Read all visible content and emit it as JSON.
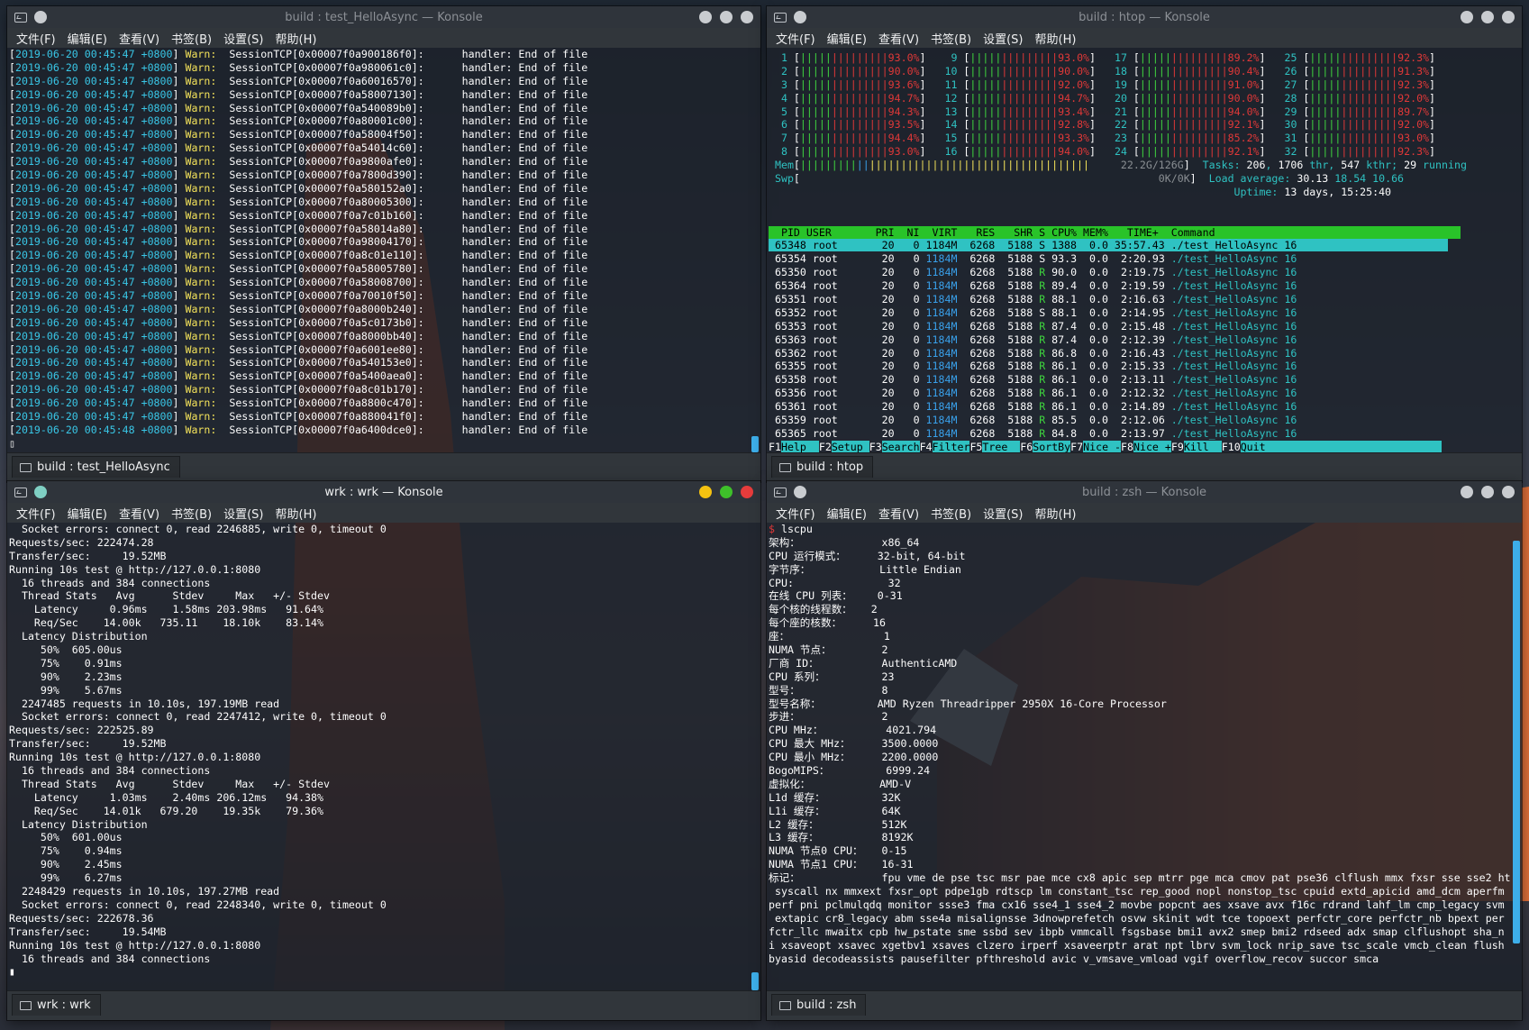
{
  "wallpaper": {
    "desc_colors": [
      "#1f2833",
      "#c2512a",
      "#e0703a"
    ]
  },
  "w1": {
    "title": "build : test_HelloAsync — Konsole",
    "tab": "build : test_HelloAsync",
    "menu": [
      "文件(F)",
      "编辑(E)",
      "查看(V)",
      "书签(B)",
      "设置(S)",
      "帮助(H)"
    ],
    "rows": [
      {
        "ts": "2019-06-20 00:45:47 +0800",
        "ptr": "0x00007f0a900186f0"
      },
      {
        "ts": "2019-06-20 00:45:47 +0800",
        "ptr": "0x00007f0a980061c0"
      },
      {
        "ts": "2019-06-20 00:45:47 +0800",
        "ptr": "0x00007f0a60016570"
      },
      {
        "ts": "2019-06-20 00:45:47 +0800",
        "ptr": "0x00007f0a58007130"
      },
      {
        "ts": "2019-06-20 00:45:47 +0800",
        "ptr": "0x00007f0a540089b0"
      },
      {
        "ts": "2019-06-20 00:45:47 +0800",
        "ptr": "0x00007f0a80001c00"
      },
      {
        "ts": "2019-06-20 00:45:47 +0800",
        "ptr": "0x00007f0a58004f50"
      },
      {
        "ts": "2019-06-20 00:45:47 +0800",
        "ptr": "0x00007f0a54014c60"
      },
      {
        "ts": "2019-06-20 00:45:47 +0800",
        "ptr": "0x00007f0a9800afe0"
      },
      {
        "ts": "2019-06-20 00:45:47 +0800",
        "ptr": "0x00007f0a7800d390"
      },
      {
        "ts": "2019-06-20 00:45:47 +0800",
        "ptr": "0x00007f0a580152a0"
      },
      {
        "ts": "2019-06-20 00:45:47 +0800",
        "ptr": "0x00007f0a80005300"
      },
      {
        "ts": "2019-06-20 00:45:47 +0800",
        "ptr": "0x00007f0a7c01b160"
      },
      {
        "ts": "2019-06-20 00:45:47 +0800",
        "ptr": "0x00007f0a58014a80"
      },
      {
        "ts": "2019-06-20 00:45:47 +0800",
        "ptr": "0x00007f0a98004170"
      },
      {
        "ts": "2019-06-20 00:45:47 +0800",
        "ptr": "0x00007f0a8c01e110"
      },
      {
        "ts": "2019-06-20 00:45:47 +0800",
        "ptr": "0x00007f0a58005780"
      },
      {
        "ts": "2019-06-20 00:45:47 +0800",
        "ptr": "0x00007f0a58008700"
      },
      {
        "ts": "2019-06-20 00:45:47 +0800",
        "ptr": "0x00007f0a70010f50"
      },
      {
        "ts": "2019-06-20 00:45:47 +0800",
        "ptr": "0x00007f0a8000b240"
      },
      {
        "ts": "2019-06-20 00:45:47 +0800",
        "ptr": "0x00007f0a5c0173b0"
      },
      {
        "ts": "2019-06-20 00:45:47 +0800",
        "ptr": "0x00007f0a8000bb40"
      },
      {
        "ts": "2019-06-20 00:45:47 +0800",
        "ptr": "0x00007f0a6001ee80"
      },
      {
        "ts": "2019-06-20 00:45:47 +0800",
        "ptr": "0x00007f0a540153e0"
      },
      {
        "ts": "2019-06-20 00:45:47 +0800",
        "ptr": "0x00007f0a5400aea0"
      },
      {
        "ts": "2019-06-20 00:45:47 +0800",
        "ptr": "0x00007f0a8c01b170"
      },
      {
        "ts": "2019-06-20 00:45:47 +0800",
        "ptr": "0x00007f0a8800c470"
      },
      {
        "ts": "2019-06-20 00:45:47 +0800",
        "ptr": "0x00007f0a880041f0"
      },
      {
        "ts": "2019-06-20 00:45:48 +0800",
        "ptr": "0x00007f0a6400dce0"
      }
    ],
    "level": "Warn:",
    "prefix": "SessionTCP",
    "msg": "handler: End of file"
  },
  "w2": {
    "title": "build : htop — Konsole",
    "tab": "build : htop",
    "menu": [
      "文件(F)",
      "编辑(E)",
      "查看(V)",
      "书签(B)",
      "设置(S)",
      "帮助(H)"
    ],
    "cpus": [
      {
        "n": "1",
        "pct": "93.0%"
      },
      {
        "n": "2",
        "pct": "90.0%"
      },
      {
        "n": "3",
        "pct": "93.6%"
      },
      {
        "n": "4",
        "pct": "94.7%"
      },
      {
        "n": "5",
        "pct": "94.3%"
      },
      {
        "n": "6",
        "pct": "93.5%"
      },
      {
        "n": "7",
        "pct": "94.4%"
      },
      {
        "n": "8",
        "pct": "93.0%"
      },
      {
        "n": "9",
        "pct": "93.0%"
      },
      {
        "n": "10",
        "pct": "90.0%"
      },
      {
        "n": "11",
        "pct": "92.0%"
      },
      {
        "n": "12",
        "pct": "94.7%"
      },
      {
        "n": "13",
        "pct": "93.4%"
      },
      {
        "n": "14",
        "pct": "92.8%"
      },
      {
        "n": "15",
        "pct": "93.3%"
      },
      {
        "n": "16",
        "pct": "94.0%"
      },
      {
        "n": "17",
        "pct": "89.2%"
      },
      {
        "n": "18",
        "pct": "90.4%"
      },
      {
        "n": "19",
        "pct": "91.0%"
      },
      {
        "n": "20",
        "pct": "90.0%"
      },
      {
        "n": "21",
        "pct": "94.0%"
      },
      {
        "n": "22",
        "pct": "92.1%"
      },
      {
        "n": "23",
        "pct": "85.2%"
      },
      {
        "n": "24",
        "pct": "92.1%"
      },
      {
        "n": "25",
        "pct": "92.3%"
      },
      {
        "n": "26",
        "pct": "91.3%"
      },
      {
        "n": "27",
        "pct": "92.3%"
      },
      {
        "n": "28",
        "pct": "92.0%"
      },
      {
        "n": "29",
        "pct": "89.7%"
      },
      {
        "n": "30",
        "pct": "92.0%"
      },
      {
        "n": "31",
        "pct": "93.0%"
      },
      {
        "n": "32",
        "pct": "92.3%"
      }
    ],
    "mem_label": "Mem",
    "mem_val": "22.2G/126G",
    "swp_label": "Swp",
    "swp_val": "0K/0K",
    "tasks_label": "Tasks:",
    "tasks": "206",
    "thr": "1706",
    "thr_label": "thr,",
    "kthr": "547",
    "kthr_label": "kthr;",
    "running": "29",
    "running_label": "running",
    "load_label": "Load average:",
    "load1": "30.13",
    "load5": "18.54",
    "load15": "10.66",
    "uptime_label": "Uptime:",
    "uptime": "13 days, 15:25:40",
    "header": "  PID USER       PRI  NI  VIRT   RES   SHR S CPU% MEM%   TIME+  Command                                       ",
    "procs": [
      {
        "pid": "65348",
        "user": "root",
        "pri": "20",
        "ni": "0",
        "virt": "1184M",
        "res": "6268",
        "shr": "5188",
        "s": "S",
        "cpu": "1388",
        "mem": "0.0",
        "time": "35:57.43",
        "cmd": "./test_HelloAsync 16"
      },
      {
        "pid": "65354",
        "user": "root",
        "pri": "20",
        "ni": "0",
        "virt": "1184M",
        "res": "6268",
        "shr": "5188",
        "s": "S",
        "cpu": "93.3",
        "mem": "0.0",
        "time": "2:20.93",
        "cmd": "./test_HelloAsync 16"
      },
      {
        "pid": "65350",
        "user": "root",
        "pri": "20",
        "ni": "0",
        "virt": "1184M",
        "res": "6268",
        "shr": "5188",
        "s": "R",
        "cpu": "90.0",
        "mem": "0.0",
        "time": "2:19.75",
        "cmd": "./test_HelloAsync 16"
      },
      {
        "pid": "65364",
        "user": "root",
        "pri": "20",
        "ni": "0",
        "virt": "1184M",
        "res": "6268",
        "shr": "5188",
        "s": "R",
        "cpu": "89.4",
        "mem": "0.0",
        "time": "2:19.59",
        "cmd": "./test_HelloAsync 16"
      },
      {
        "pid": "65351",
        "user": "root",
        "pri": "20",
        "ni": "0",
        "virt": "1184M",
        "res": "6268",
        "shr": "5188",
        "s": "R",
        "cpu": "88.1",
        "mem": "0.0",
        "time": "2:16.63",
        "cmd": "./test_HelloAsync 16"
      },
      {
        "pid": "65352",
        "user": "root",
        "pri": "20",
        "ni": "0",
        "virt": "1184M",
        "res": "6268",
        "shr": "5188",
        "s": "S",
        "cpu": "88.1",
        "mem": "0.0",
        "time": "2:14.95",
        "cmd": "./test_HelloAsync 16"
      },
      {
        "pid": "65353",
        "user": "root",
        "pri": "20",
        "ni": "0",
        "virt": "1184M",
        "res": "6268",
        "shr": "5188",
        "s": "R",
        "cpu": "87.4",
        "mem": "0.0",
        "time": "2:15.48",
        "cmd": "./test_HelloAsync 16"
      },
      {
        "pid": "65363",
        "user": "root",
        "pri": "20",
        "ni": "0",
        "virt": "1184M",
        "res": "6268",
        "shr": "5188",
        "s": "R",
        "cpu": "87.4",
        "mem": "0.0",
        "time": "2:12.39",
        "cmd": "./test_HelloAsync 16"
      },
      {
        "pid": "65362",
        "user": "root",
        "pri": "20",
        "ni": "0",
        "virt": "1184M",
        "res": "6268",
        "shr": "5188",
        "s": "R",
        "cpu": "86.8",
        "mem": "0.0",
        "time": "2:16.43",
        "cmd": "./test_HelloAsync 16"
      },
      {
        "pid": "65355",
        "user": "root",
        "pri": "20",
        "ni": "0",
        "virt": "1184M",
        "res": "6268",
        "shr": "5188",
        "s": "R",
        "cpu": "86.1",
        "mem": "0.0",
        "time": "2:15.33",
        "cmd": "./test_HelloAsync 16"
      },
      {
        "pid": "65358",
        "user": "root",
        "pri": "20",
        "ni": "0",
        "virt": "1184M",
        "res": "6268",
        "shr": "5188",
        "s": "R",
        "cpu": "86.1",
        "mem": "0.0",
        "time": "2:13.11",
        "cmd": "./test_HelloAsync 16"
      },
      {
        "pid": "65356",
        "user": "root",
        "pri": "20",
        "ni": "0",
        "virt": "1184M",
        "res": "6268",
        "shr": "5188",
        "s": "R",
        "cpu": "86.1",
        "mem": "0.0",
        "time": "2:12.32",
        "cmd": "./test_HelloAsync 16"
      },
      {
        "pid": "65361",
        "user": "root",
        "pri": "20",
        "ni": "0",
        "virt": "1184M",
        "res": "6268",
        "shr": "5188",
        "s": "R",
        "cpu": "86.1",
        "mem": "0.0",
        "time": "2:14.89",
        "cmd": "./test_HelloAsync 16"
      },
      {
        "pid": "65359",
        "user": "root",
        "pri": "20",
        "ni": "0",
        "virt": "1184M",
        "res": "6268",
        "shr": "5188",
        "s": "R",
        "cpu": "85.5",
        "mem": "0.0",
        "time": "2:12.06",
        "cmd": "./test_HelloAsync 16"
      },
      {
        "pid": "65365",
        "user": "root",
        "pri": "20",
        "ni": "0",
        "virt": "1184M",
        "res": "6268",
        "shr": "5188",
        "s": "R",
        "cpu": "84.8",
        "mem": "0.0",
        "time": "2:13.97",
        "cmd": "./test_HelloAsync 16"
      }
    ],
    "fkeys": [
      {
        "k": "F1",
        "l": "Help  "
      },
      {
        "k": "F2",
        "l": "Setup "
      },
      {
        "k": "F3",
        "l": "Search"
      },
      {
        "k": "F4",
        "l": "Filter"
      },
      {
        "k": "F5",
        "l": "Tree  "
      },
      {
        "k": "F6",
        "l": "SortBy"
      },
      {
        "k": "F7",
        "l": "Nice -"
      },
      {
        "k": "F8",
        "l": "Nice +"
      },
      {
        "k": "F9",
        "l": "Kill  "
      },
      {
        "k": "F10",
        "l": "Quit  "
      }
    ]
  },
  "w3": {
    "title": "wrk : wrk — Konsole",
    "tab": "wrk : wrk",
    "menu": [
      "文件(F)",
      "编辑(E)",
      "查看(V)",
      "书签(B)",
      "设置(S)",
      "帮助(H)"
    ],
    "lines": [
      "  Socket errors: connect 0, read 2246885, write 0, timeout 0",
      "Requests/sec: 222474.28",
      "Transfer/sec:     19.52MB",
      "Running 10s test @ http://127.0.0.1:8080",
      "  16 threads and 384 connections",
      "  Thread Stats   Avg      Stdev     Max   +/- Stdev",
      "    Latency     0.96ms    1.58ms 203.98ms   91.64%",
      "    Req/Sec    14.00k   735.11    18.10k    83.14%",
      "  Latency Distribution",
      "     50%  605.00us",
      "     75%    0.91ms",
      "     90%    2.23ms",
      "     99%    5.67ms",
      "  2247485 requests in 10.10s, 197.19MB read",
      "  Socket errors: connect 0, read 2247412, write 0, timeout 0",
      "Requests/sec: 222525.89",
      "Transfer/sec:     19.52MB",
      "Running 10s test @ http://127.0.0.1:8080",
      "  16 threads and 384 connections",
      "  Thread Stats   Avg      Stdev     Max   +/- Stdev",
      "    Latency     1.03ms    2.40ms 206.12ms   94.38%",
      "    Req/Sec    14.01k   679.20    19.35k    79.36%",
      "  Latency Distribution",
      "     50%  601.00us",
      "     75%    0.94ms",
      "     90%    2.45ms",
      "     99%    6.27ms",
      "  2248429 requests in 10.10s, 197.27MB read",
      "  Socket errors: connect 0, read 2248340, write 0, timeout 0",
      "Requests/sec: 222678.36",
      "Transfer/sec:     19.54MB",
      "Running 10s test @ http://127.0.0.1:8080",
      "  16 threads and 384 connections"
    ]
  },
  "w4": {
    "title": "build : zsh — Konsole",
    "tab": "build : zsh",
    "menu": [
      "文件(F)",
      "编辑(E)",
      "查看(V)",
      "书签(B)",
      "设置(S)",
      "帮助(H)"
    ],
    "prompt": "$",
    "cmd": " lscpu",
    "lines": [
      "架构：             x86_64",
      "CPU 运行模式：     32-bit, 64-bit",
      "字节序：           Little Endian",
      "CPU:               32",
      "在线 CPU 列表：    0-31",
      "每个核的线程数：   2",
      "每个座的核数：     16",
      "座：               1",
      "NUMA 节点：        2",
      "厂商 ID：          AuthenticAMD",
      "CPU 系列：         23",
      "型号：             8",
      "型号名称：         AMD Ryzen Threadripper 2950X 16-Core Processor",
      "步进：             2",
      "CPU MHz：          4021.794",
      "CPU 最大 MHz：     3500.0000",
      "CPU 最小 MHz：     2200.0000",
      "BogoMIPS：         6999.24",
      "虚拟化：           AMD-V",
      "L1d 缓存：         32K",
      "L1i 缓存：         64K",
      "L2 缓存：          512K",
      "L3 缓存：          8192K",
      "NUMA 节点0 CPU：   0-15",
      "NUMA 节点1 CPU：   16-31",
      "标记：             fpu vme de pse tsc msr pae mce cx8 apic sep mtrr pge mca cmov pat pse36 clflush mmx fxsr sse sse2 ht",
      " syscall nx mmxext fxsr_opt pdpe1gb rdtscp lm constant_tsc rep_good nopl nonstop_tsc cpuid extd_apicid amd_dcm aperfm",
      "perf pni pclmulqdq monitor ssse3 fma cx16 sse4_1 sse4_2 movbe popcnt aes xsave avx f16c rdrand lahf_lm cmp_legacy svm",
      " extapic cr8_legacy abm sse4a misalignsse 3dnowprefetch osvw skinit wdt tce topoext perfctr_core perfctr_nb bpext per",
      "fctr_llc mwaitx cpb hw_pstate sme ssbd sev ibpb vmmcall fsgsbase bmi1 avx2 smep bmi2 rdseed adx smap clflushopt sha_n",
      "i xsaveopt xsavec xgetbv1 xsaves clzero irperf xsaveerptr arat npt lbrv svm_lock nrip_save tsc_scale vmcb_clean flush",
      "byasid decodeassists pausefilter pfthreshold avic v_vmsave_vmload vgif overflow_recov succor smca"
    ]
  }
}
